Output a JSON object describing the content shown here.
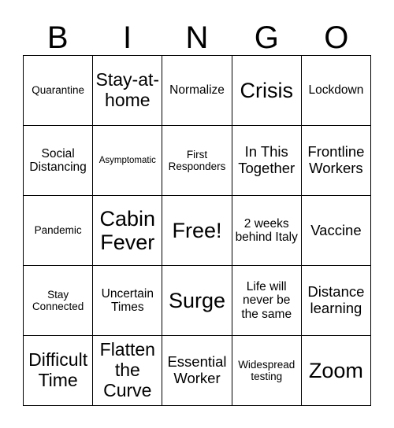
{
  "card": {
    "title": "BINGO",
    "header_letters": [
      "B",
      "I",
      "N",
      "G",
      "O"
    ],
    "border_color": "#000000",
    "background_color": "#ffffff",
    "text_color": "#000000",
    "rows": 5,
    "columns": 5,
    "rows_data": [
      [
        {
          "text": "Quarantine",
          "size": "sz-s"
        },
        {
          "text": "Stay-at-home",
          "size": "sz-xl"
        },
        {
          "text": "Normalize",
          "size": "sz-m"
        },
        {
          "text": "Crisis",
          "size": "sz-xxl"
        },
        {
          "text": "Lockdown",
          "size": "sz-m"
        }
      ],
      [
        {
          "text": "Social Distancing",
          "size": "sz-m"
        },
        {
          "text": "Asymptomatic",
          "size": "sz-xs"
        },
        {
          "text": "First Responders",
          "size": "sz-s"
        },
        {
          "text": "In This Together",
          "size": "sz-l"
        },
        {
          "text": "Frontline Workers",
          "size": "sz-l"
        }
      ],
      [
        {
          "text": "Pandemic",
          "size": "sz-s"
        },
        {
          "text": "Cabin Fever",
          "size": "sz-xxl"
        },
        {
          "text": "Free!",
          "size": "sz-xxl"
        },
        {
          "text": "2 weeks behind Italy",
          "size": "sz-m"
        },
        {
          "text": "Vaccine",
          "size": "sz-l"
        }
      ],
      [
        {
          "text": "Stay Connected",
          "size": "sz-s"
        },
        {
          "text": "Uncertain Times",
          "size": "sz-m"
        },
        {
          "text": "Surge",
          "size": "sz-xxl"
        },
        {
          "text": "Life will never be the same",
          "size": "sz-m"
        },
        {
          "text": "Distance learning",
          "size": "sz-l"
        }
      ],
      [
        {
          "text": "Difficult Time",
          "size": "sz-xl"
        },
        {
          "text": "Flatten the Curve",
          "size": "sz-xl"
        },
        {
          "text": "Essential Worker",
          "size": "sz-l"
        },
        {
          "text": "Widespread testing",
          "size": "sz-s"
        },
        {
          "text": "Zoom",
          "size": "sz-xxl"
        }
      ]
    ]
  }
}
